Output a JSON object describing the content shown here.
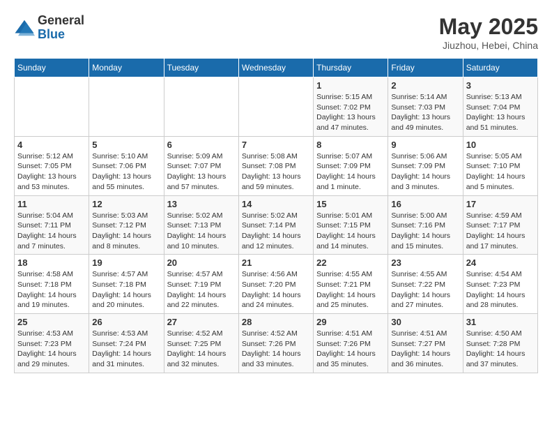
{
  "header": {
    "logo_general": "General",
    "logo_blue": "Blue",
    "month_title": "May 2025",
    "location": "Jiuzhou, Hebei, China"
  },
  "weekdays": [
    "Sunday",
    "Monday",
    "Tuesday",
    "Wednesday",
    "Thursday",
    "Friday",
    "Saturday"
  ],
  "weeks": [
    [
      {
        "day": "",
        "info": ""
      },
      {
        "day": "",
        "info": ""
      },
      {
        "day": "",
        "info": ""
      },
      {
        "day": "",
        "info": ""
      },
      {
        "day": "1",
        "info": "Sunrise: 5:15 AM\nSunset: 7:02 PM\nDaylight: 13 hours\nand 47 minutes."
      },
      {
        "day": "2",
        "info": "Sunrise: 5:14 AM\nSunset: 7:03 PM\nDaylight: 13 hours\nand 49 minutes."
      },
      {
        "day": "3",
        "info": "Sunrise: 5:13 AM\nSunset: 7:04 PM\nDaylight: 13 hours\nand 51 minutes."
      }
    ],
    [
      {
        "day": "4",
        "info": "Sunrise: 5:12 AM\nSunset: 7:05 PM\nDaylight: 13 hours\nand 53 minutes."
      },
      {
        "day": "5",
        "info": "Sunrise: 5:10 AM\nSunset: 7:06 PM\nDaylight: 13 hours\nand 55 minutes."
      },
      {
        "day": "6",
        "info": "Sunrise: 5:09 AM\nSunset: 7:07 PM\nDaylight: 13 hours\nand 57 minutes."
      },
      {
        "day": "7",
        "info": "Sunrise: 5:08 AM\nSunset: 7:08 PM\nDaylight: 13 hours\nand 59 minutes."
      },
      {
        "day": "8",
        "info": "Sunrise: 5:07 AM\nSunset: 7:09 PM\nDaylight: 14 hours\nand 1 minute."
      },
      {
        "day": "9",
        "info": "Sunrise: 5:06 AM\nSunset: 7:09 PM\nDaylight: 14 hours\nand 3 minutes."
      },
      {
        "day": "10",
        "info": "Sunrise: 5:05 AM\nSunset: 7:10 PM\nDaylight: 14 hours\nand 5 minutes."
      }
    ],
    [
      {
        "day": "11",
        "info": "Sunrise: 5:04 AM\nSunset: 7:11 PM\nDaylight: 14 hours\nand 7 minutes."
      },
      {
        "day": "12",
        "info": "Sunrise: 5:03 AM\nSunset: 7:12 PM\nDaylight: 14 hours\nand 8 minutes."
      },
      {
        "day": "13",
        "info": "Sunrise: 5:02 AM\nSunset: 7:13 PM\nDaylight: 14 hours\nand 10 minutes."
      },
      {
        "day": "14",
        "info": "Sunrise: 5:02 AM\nSunset: 7:14 PM\nDaylight: 14 hours\nand 12 minutes."
      },
      {
        "day": "15",
        "info": "Sunrise: 5:01 AM\nSunset: 7:15 PM\nDaylight: 14 hours\nand 14 minutes."
      },
      {
        "day": "16",
        "info": "Sunrise: 5:00 AM\nSunset: 7:16 PM\nDaylight: 14 hours\nand 15 minutes."
      },
      {
        "day": "17",
        "info": "Sunrise: 4:59 AM\nSunset: 7:17 PM\nDaylight: 14 hours\nand 17 minutes."
      }
    ],
    [
      {
        "day": "18",
        "info": "Sunrise: 4:58 AM\nSunset: 7:18 PM\nDaylight: 14 hours\nand 19 minutes."
      },
      {
        "day": "19",
        "info": "Sunrise: 4:57 AM\nSunset: 7:18 PM\nDaylight: 14 hours\nand 20 minutes."
      },
      {
        "day": "20",
        "info": "Sunrise: 4:57 AM\nSunset: 7:19 PM\nDaylight: 14 hours\nand 22 minutes."
      },
      {
        "day": "21",
        "info": "Sunrise: 4:56 AM\nSunset: 7:20 PM\nDaylight: 14 hours\nand 24 minutes."
      },
      {
        "day": "22",
        "info": "Sunrise: 4:55 AM\nSunset: 7:21 PM\nDaylight: 14 hours\nand 25 minutes."
      },
      {
        "day": "23",
        "info": "Sunrise: 4:55 AM\nSunset: 7:22 PM\nDaylight: 14 hours\nand 27 minutes."
      },
      {
        "day": "24",
        "info": "Sunrise: 4:54 AM\nSunset: 7:23 PM\nDaylight: 14 hours\nand 28 minutes."
      }
    ],
    [
      {
        "day": "25",
        "info": "Sunrise: 4:53 AM\nSunset: 7:23 PM\nDaylight: 14 hours\nand 29 minutes."
      },
      {
        "day": "26",
        "info": "Sunrise: 4:53 AM\nSunset: 7:24 PM\nDaylight: 14 hours\nand 31 minutes."
      },
      {
        "day": "27",
        "info": "Sunrise: 4:52 AM\nSunset: 7:25 PM\nDaylight: 14 hours\nand 32 minutes."
      },
      {
        "day": "28",
        "info": "Sunrise: 4:52 AM\nSunset: 7:26 PM\nDaylight: 14 hours\nand 33 minutes."
      },
      {
        "day": "29",
        "info": "Sunrise: 4:51 AM\nSunset: 7:26 PM\nDaylight: 14 hours\nand 35 minutes."
      },
      {
        "day": "30",
        "info": "Sunrise: 4:51 AM\nSunset: 7:27 PM\nDaylight: 14 hours\nand 36 minutes."
      },
      {
        "day": "31",
        "info": "Sunrise: 4:50 AM\nSunset: 7:28 PM\nDaylight: 14 hours\nand 37 minutes."
      }
    ]
  ]
}
